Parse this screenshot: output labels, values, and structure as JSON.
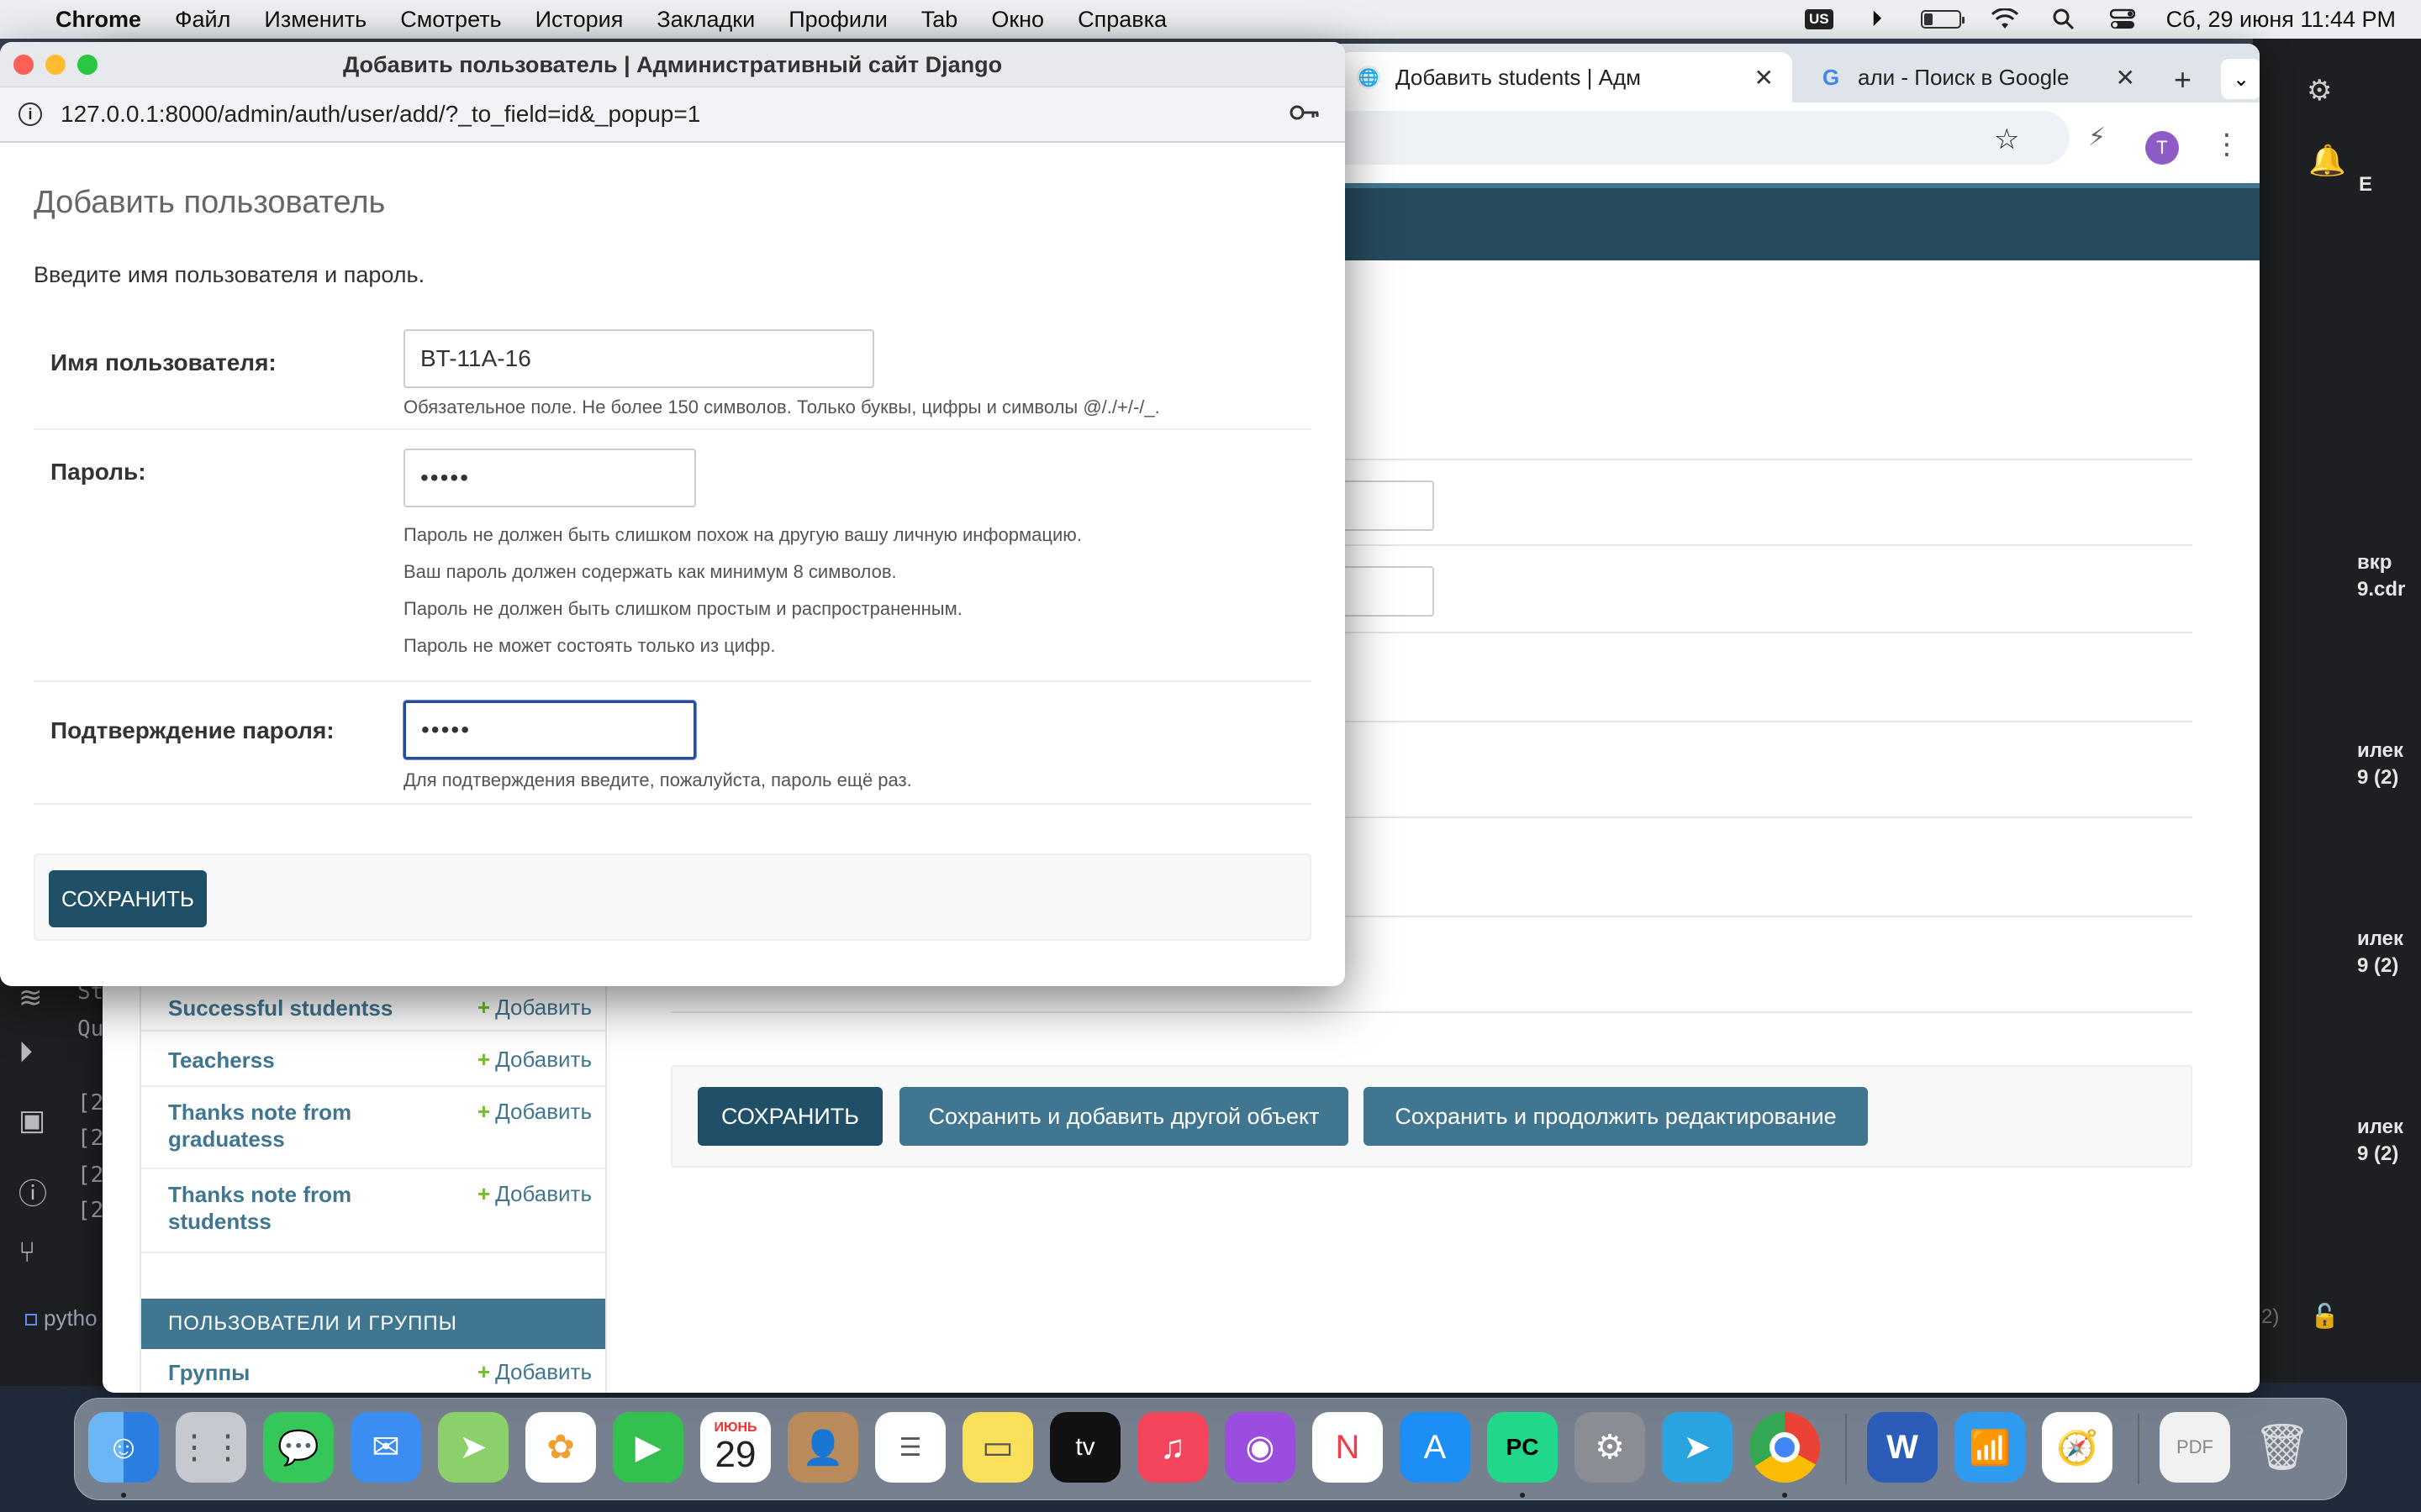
{
  "menubar": {
    "app": "Chrome",
    "items": [
      "Файл",
      "Изменить",
      "Смотреть",
      "История",
      "Закладки",
      "Профили",
      "Tab",
      "Окно",
      "Справка"
    ],
    "input_source": "US",
    "datetime": "Сб, 29 июня  11:44 PM"
  },
  "browser_bg": {
    "tabs": [
      {
        "title": "Добавить students | Адм",
        "icon": "globe-icon"
      },
      {
        "title": "али - Поиск в Google",
        "icon": "google-icon"
      }
    ],
    "avatar_letter": "T",
    "buttons": {
      "save": "СОХРАНИТЬ",
      "save_add": "Сохранить и добавить другой объект",
      "save_continue": "Сохранить и продолжить редактирование"
    },
    "sidebar": {
      "rows": [
        {
          "name": "Successful studentss",
          "add": "Добавить"
        },
        {
          "name": "Teacherss",
          "add": "Добавить"
        },
        {
          "name": "Thanks note from graduatess",
          "add": "Добавить"
        },
        {
          "name": "Thanks note from studentss",
          "add": "Добавить"
        }
      ],
      "section_caption": "ПОЛЬЗОВАТЕЛИ И ГРУППЫ",
      "groups": {
        "name": "Группы",
        "add": "Добавить"
      }
    }
  },
  "ide": {
    "right_labels": [
      "E",
      "вкр",
      "9.cdr",
      "илек",
      "9 (2)",
      "илек",
      "9 (2)",
      "илек",
      "9 (2)",
      "2)"
    ],
    "left_code": [
      "St",
      "Qu",
      "[2",
      "[2",
      "[2",
      "[2"
    ],
    "status": "pytho"
  },
  "popup": {
    "window_title": "Добавить пользователь | Административный сайт Django",
    "url": "127.0.0.1:8000/admin/auth/user/add/?_to_field=id&_popup=1",
    "heading": "Добавить пользователь",
    "intro": "Введите имя пользователя и пароль.",
    "username": {
      "label": "Имя пользователя:",
      "value": "BT-11A-16",
      "help": "Обязательное поле. Не более 150 символов. Только буквы, цифры и символы @/./+/-/_."
    },
    "password": {
      "label": "Пароль:",
      "value": "•••••",
      "help": [
        "Пароль не должен быть слишком похож на другую вашу личную информацию.",
        "Ваш пароль должен содержать как минимум 8 символов.",
        "Пароль не должен быть слишком простым и распространенным.",
        "Пароль не может состоять только из цифр."
      ]
    },
    "password2": {
      "label": "Подтверждение пароля:",
      "value": "•••••",
      "help": "Для подтверждения введите, пожалуйста, пароль ещё раз."
    },
    "save_button": "СОХРАНИТЬ"
  },
  "dock": {
    "calendar_month": "ИЮНЬ",
    "calendar_day": "29",
    "apps": [
      "finder",
      "launchpad",
      "messages",
      "mail",
      "maps",
      "photos",
      "facetime",
      "calendar",
      "contacts",
      "reminders",
      "notes",
      "tv",
      "music",
      "podcasts",
      "news",
      "app-store",
      "pycharm",
      "system-settings",
      "telegram",
      "chrome",
      "word",
      "wifi-utility",
      "safari",
      "pdf-document",
      "trash"
    ]
  }
}
